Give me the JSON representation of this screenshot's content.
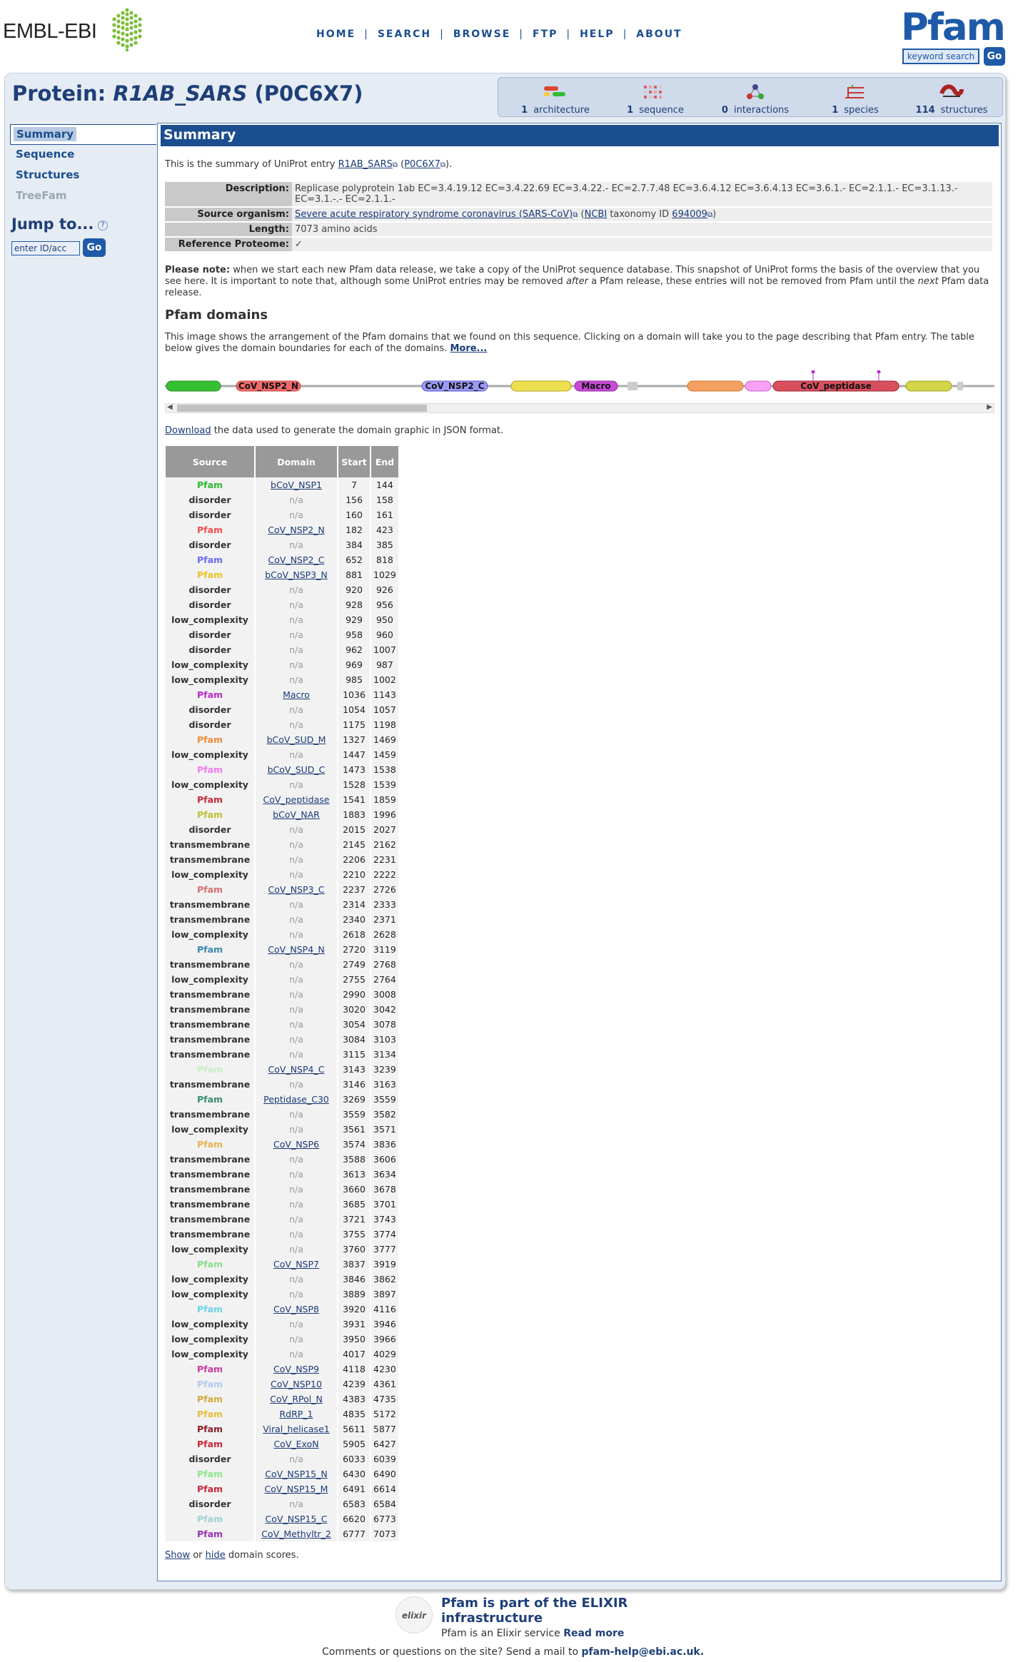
{
  "header": {
    "ebi_logo_text": "EMBL-EBI",
    "nav": [
      "HOME",
      "SEARCH",
      "BROWSE",
      "FTP",
      "HELP",
      "ABOUT"
    ],
    "pfam_logo": "Pfam",
    "keyword_search": "keyword search",
    "go": "Go"
  },
  "title": {
    "prefix": "Protein:",
    "name": "R1AB_SARS",
    "accession": "(P0C6X7)"
  },
  "tabs": [
    {
      "count": "1",
      "label": "architecture",
      "color": "#d43"
    },
    {
      "count": "1",
      "label": "sequence",
      "color": "#c66"
    },
    {
      "count": "0",
      "label": "interactions",
      "color": "#448"
    },
    {
      "count": "1",
      "label": "species",
      "color": "#c33"
    },
    {
      "count": "114",
      "label": "structures",
      "color": "#a22"
    }
  ],
  "sidebar": {
    "items": [
      "Summary",
      "Sequence",
      "Structures",
      "TreeFam"
    ],
    "jump_title": "Jump to...",
    "jump_help": "?",
    "jump_placeholder": "enter ID/acc",
    "jump_go": "Go"
  },
  "summary": {
    "heading": "Summary",
    "intro_pre": "This is the summary of UniProt entry",
    "intro_entry": "R1AB_SARS",
    "intro_acc": "P0C6X7",
    "rows": {
      "description_label": "Description:",
      "description": "Replicase polyprotein 1ab EC=3.4.19.12 EC=3.4.22.69 EC=3.4.22.- EC=2.7.7.48 EC=3.6.4.12 EC=3.6.4.13 EC=3.6.1.- EC=2.1.1.- EC=3.1.13.- EC=3.1.-.- EC=2.1.1.-",
      "organism_label": "Source organism:",
      "organism": "Severe acute respiratory syndrome coronavirus (SARS-CoV)",
      "ncbi": "NCBI",
      "taxonomy_text": "taxonomy ID",
      "taxonomy_id": "694009",
      "length_label": "Length:",
      "length": "7073 amino acids",
      "refprot_label": "Reference Proteome:",
      "refprot": "✓"
    },
    "note_bold": "Please note:",
    "note_1": "when we start each new Pfam data release, we take a copy of the UniProt sequence database. This snapshot of UniProt forms the basis of the overview that you see here. It is important to note that, although some UniProt entries may be removed",
    "note_after": "after",
    "note_2": "a Pfam release, these entries will not be removed from Pfam until the",
    "note_next": "next",
    "note_3": "Pfam data release."
  },
  "domains_section": {
    "title": "Pfam domains",
    "desc": "This image shows the arrangement of the Pfam domains that we found on this sequence. Clicking on a domain will take you to the page describing that Pfam entry. The table below gives the domain boundaries for each of the domains.",
    "more": "More...",
    "download_link": "Download",
    "download_text": "the data used to generate the domain graphic in JSON format.",
    "graphic_labels": [
      "CoV_NSP2_N",
      "CoV_NSP2_C",
      "Macro",
      "CoV_peptidase"
    ],
    "headers": [
      "Source",
      "Domain",
      "Start",
      "End"
    ],
    "show": "Show",
    "or": "or",
    "hide": "hide",
    "show_tail": "domain scores."
  },
  "domain_rows": [
    [
      "Pfam",
      "bCoV_NSP1",
      "7",
      "144",
      "#2db92d"
    ],
    [
      "disorder",
      "n/a",
      "156",
      "158",
      ""
    ],
    [
      "disorder",
      "n/a",
      "160",
      "161",
      ""
    ],
    [
      "Pfam",
      "CoV_NSP2_N",
      "182",
      "423",
      "#f0504f"
    ],
    [
      "disorder",
      "n/a",
      "384",
      "385",
      ""
    ],
    [
      "Pfam",
      "CoV_NSP2_C",
      "652",
      "818",
      "#6a6af0"
    ],
    [
      "Pfam",
      "bCoV_NSP3_N",
      "881",
      "1029",
      "#e8c526"
    ],
    [
      "disorder",
      "n/a",
      "920",
      "926",
      ""
    ],
    [
      "disorder",
      "n/a",
      "928",
      "956",
      ""
    ],
    [
      "low_complexity",
      "n/a",
      "929",
      "950",
      ""
    ],
    [
      "disorder",
      "n/a",
      "958",
      "960",
      ""
    ],
    [
      "disorder",
      "n/a",
      "962",
      "1007",
      ""
    ],
    [
      "low_complexity",
      "n/a",
      "969",
      "987",
      ""
    ],
    [
      "low_complexity",
      "n/a",
      "985",
      "1002",
      ""
    ],
    [
      "Pfam",
      "Macro",
      "1036",
      "1143",
      "#b82dc8"
    ],
    [
      "disorder",
      "n/a",
      "1054",
      "1057",
      ""
    ],
    [
      "disorder",
      "n/a",
      "1175",
      "1198",
      ""
    ],
    [
      "Pfam",
      "bCoV_SUD_M",
      "1327",
      "1469",
      "#f08c3c"
    ],
    [
      "low_complexity",
      "n/a",
      "1447",
      "1459",
      ""
    ],
    [
      "Pfam",
      "bCoV_SUD_C",
      "1473",
      "1538",
      "#f07cf0"
    ],
    [
      "low_complexity",
      "n/a",
      "1528",
      "1539",
      ""
    ],
    [
      "Pfam",
      "CoV_peptidase",
      "1541",
      "1859",
      "#c8283c"
    ],
    [
      "Pfam",
      "bCoV_NAR",
      "1883",
      "1996",
      "#bebe32"
    ],
    [
      "disorder",
      "n/a",
      "2015",
      "2027",
      ""
    ],
    [
      "transmembrane",
      "n/a",
      "2145",
      "2162",
      ""
    ],
    [
      "transmembrane",
      "n/a",
      "2206",
      "2231",
      ""
    ],
    [
      "low_complexity",
      "n/a",
      "2210",
      "2222",
      ""
    ],
    [
      "Pfam",
      "CoV_NSP3_C",
      "2237",
      "2726",
      "#d77070"
    ],
    [
      "transmembrane",
      "n/a",
      "2314",
      "2333",
      ""
    ],
    [
      "transmembrane",
      "n/a",
      "2340",
      "2371",
      ""
    ],
    [
      "low_complexity",
      "n/a",
      "2618",
      "2628",
      ""
    ],
    [
      "Pfam",
      "CoV_NSP4_N",
      "2720",
      "3119",
      "#3a8ab0"
    ],
    [
      "transmembrane",
      "n/a",
      "2749",
      "2768",
      ""
    ],
    [
      "low_complexity",
      "n/a",
      "2755",
      "2764",
      ""
    ],
    [
      "transmembrane",
      "n/a",
      "2990",
      "3008",
      ""
    ],
    [
      "transmembrane",
      "n/a",
      "3020",
      "3042",
      ""
    ],
    [
      "transmembrane",
      "n/a",
      "3054",
      "3078",
      ""
    ],
    [
      "transmembrane",
      "n/a",
      "3084",
      "3103",
      ""
    ],
    [
      "transmembrane",
      "n/a",
      "3115",
      "3134",
      ""
    ],
    [
      "Pfam",
      "CoV_NSP4_C",
      "3143",
      "3239",
      "#c8f0c8"
    ],
    [
      "transmembrane",
      "n/a",
      "3146",
      "3163",
      ""
    ],
    [
      "Pfam",
      "Peptidase_C30",
      "3269",
      "3559",
      "#3c8c6e"
    ],
    [
      "transmembrane",
      "n/a",
      "3559",
      "3582",
      ""
    ],
    [
      "low_complexity",
      "n/a",
      "3561",
      "3571",
      ""
    ],
    [
      "Pfam",
      "CoV_NSP6",
      "3574",
      "3836",
      "#e6b450"
    ],
    [
      "transmembrane",
      "n/a",
      "3588",
      "3606",
      ""
    ],
    [
      "transmembrane",
      "n/a",
      "3613",
      "3634",
      ""
    ],
    [
      "transmembrane",
      "n/a",
      "3660",
      "3678",
      ""
    ],
    [
      "transmembrane",
      "n/a",
      "3685",
      "3701",
      ""
    ],
    [
      "transmembrane",
      "n/a",
      "3721",
      "3743",
      ""
    ],
    [
      "transmembrane",
      "n/a",
      "3755",
      "3774",
      ""
    ],
    [
      "low_complexity",
      "n/a",
      "3760",
      "3777",
      ""
    ],
    [
      "Pfam",
      "CoV_NSP7",
      "3837",
      "3919",
      "#8cdc8c"
    ],
    [
      "low_complexity",
      "n/a",
      "3846",
      "3862",
      ""
    ],
    [
      "low_complexity",
      "n/a",
      "3889",
      "3897",
      ""
    ],
    [
      "Pfam",
      "CoV_NSP8",
      "3920",
      "4116",
      "#6ed2e6"
    ],
    [
      "low_complexity",
      "n/a",
      "3931",
      "3946",
      ""
    ],
    [
      "low_complexity",
      "n/a",
      "3950",
      "3966",
      ""
    ],
    [
      "low_complexity",
      "n/a",
      "4017",
      "4029",
      ""
    ],
    [
      "Pfam",
      "CoV_NSP9",
      "4118",
      "4230",
      "#c83ca0"
    ],
    [
      "Pfam",
      "CoV_NSP10",
      "4239",
      "4361",
      "#b4c8f0"
    ],
    [
      "Pfam",
      "CoV_RPol_N",
      "4383",
      "4735",
      "#d2aa3c"
    ],
    [
      "Pfam",
      "RdRP_1",
      "4835",
      "5172",
      "#e6be3c"
    ],
    [
      "Pfam",
      "Viral_helicase1",
      "5611",
      "5877",
      "#8c1e28"
    ],
    [
      "Pfam",
      "CoV_ExoN",
      "5905",
      "6427",
      "#c8283c"
    ],
    [
      "disorder",
      "n/a",
      "6033",
      "6039",
      ""
    ],
    [
      "Pfam",
      "CoV_NSP15_N",
      "6430",
      "6490",
      "#8ce68c"
    ],
    [
      "Pfam",
      "CoV_NSP15_M",
      "6491",
      "6614",
      "#c8283c"
    ],
    [
      "disorder",
      "n/a",
      "6583",
      "6584",
      ""
    ],
    [
      "Pfam",
      "CoV_NSP15_C",
      "6620",
      "6773",
      "#a0d2d2"
    ],
    [
      "Pfam",
      "CoV_Methyltr_2",
      "6777",
      "7073",
      "#9632b4"
    ]
  ],
  "footer": {
    "elixir_logo": "elixir",
    "elixir_title_1": "Pfam is part of the ELIXIR",
    "elixir_title_2": "infrastructure",
    "elixir_sub": "Pfam is an Elixir service",
    "read_more": "Read more",
    "contact_text": "Comments or questions on the site? Send a mail to",
    "contact_email": "pfam-help@ebi.ac.uk."
  }
}
